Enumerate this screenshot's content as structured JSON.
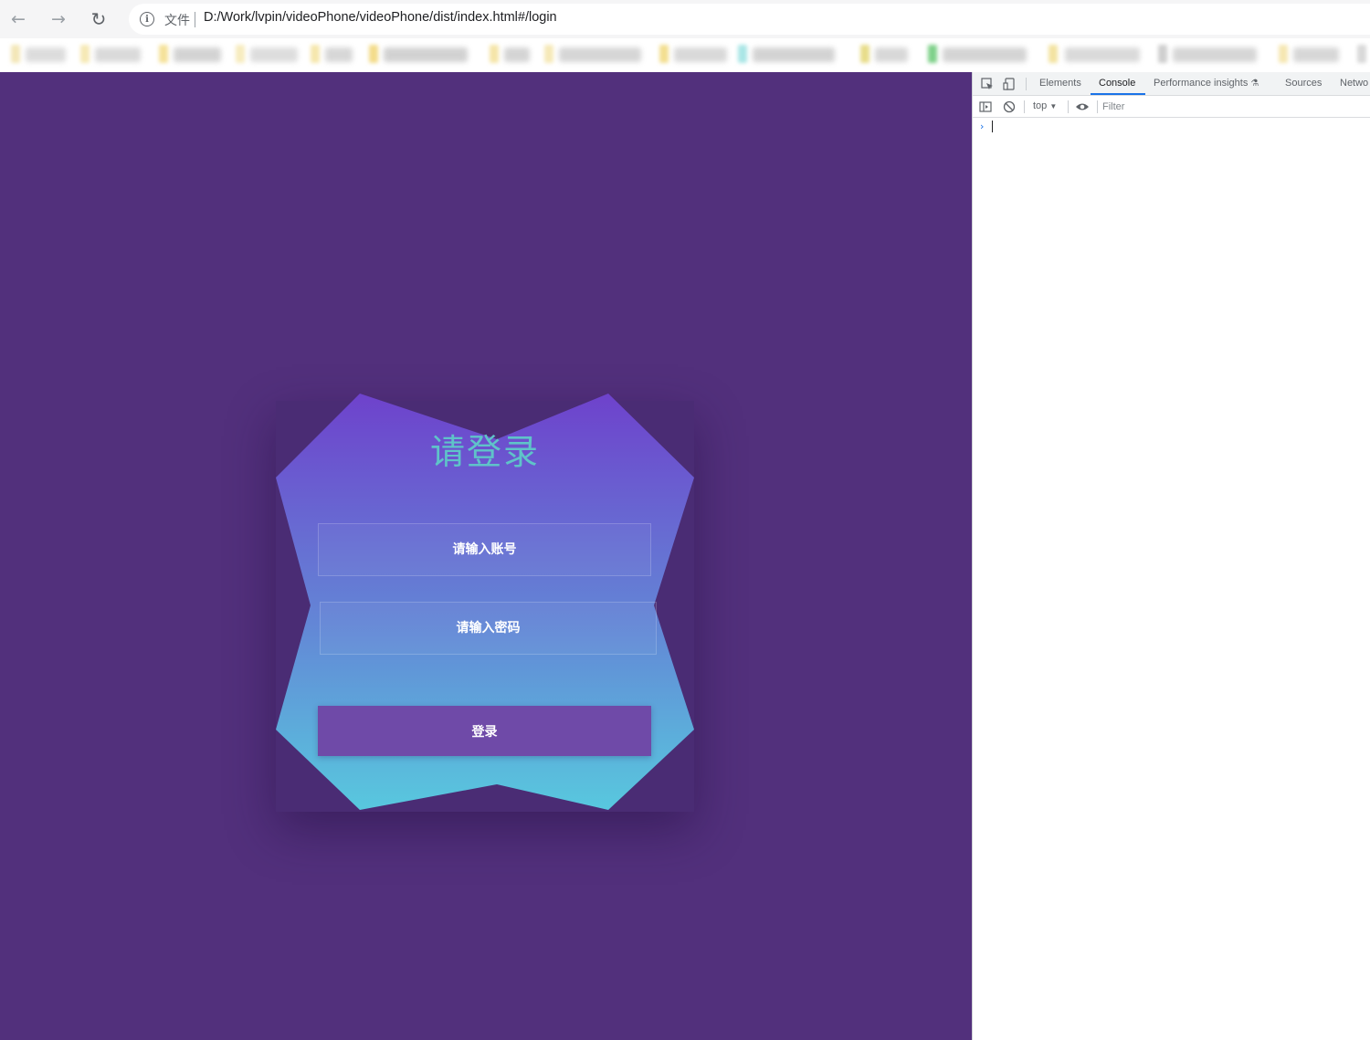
{
  "browser": {
    "nav": {
      "back_icon": "←",
      "forward_icon": "→",
      "reload_icon": "↻"
    },
    "address": {
      "info_glyph": "i",
      "scheme_label": "文件",
      "url": "D:/Work/lvpin/videoPhone/videoPhone/dist/index.html#/login"
    }
  },
  "login": {
    "title": "请登录",
    "username_placeholder": "请输入账号",
    "password_placeholder": "请输入密码",
    "submit_label": "登录"
  },
  "devtools": {
    "tabs": [
      "Elements",
      "Console",
      "Performance insights",
      "Sources",
      "Netwo"
    ],
    "active_tab": "Console",
    "context": "top",
    "filter_placeholder": "Filter",
    "prompt": "›"
  },
  "colors": {
    "page_background": "#52307c",
    "card_top": "#6f44c9",
    "card_bottom": "#58c6dd",
    "title": "#5fc3c9",
    "button": "#6f4aa8",
    "devtools_accent": "#1a73e8"
  }
}
